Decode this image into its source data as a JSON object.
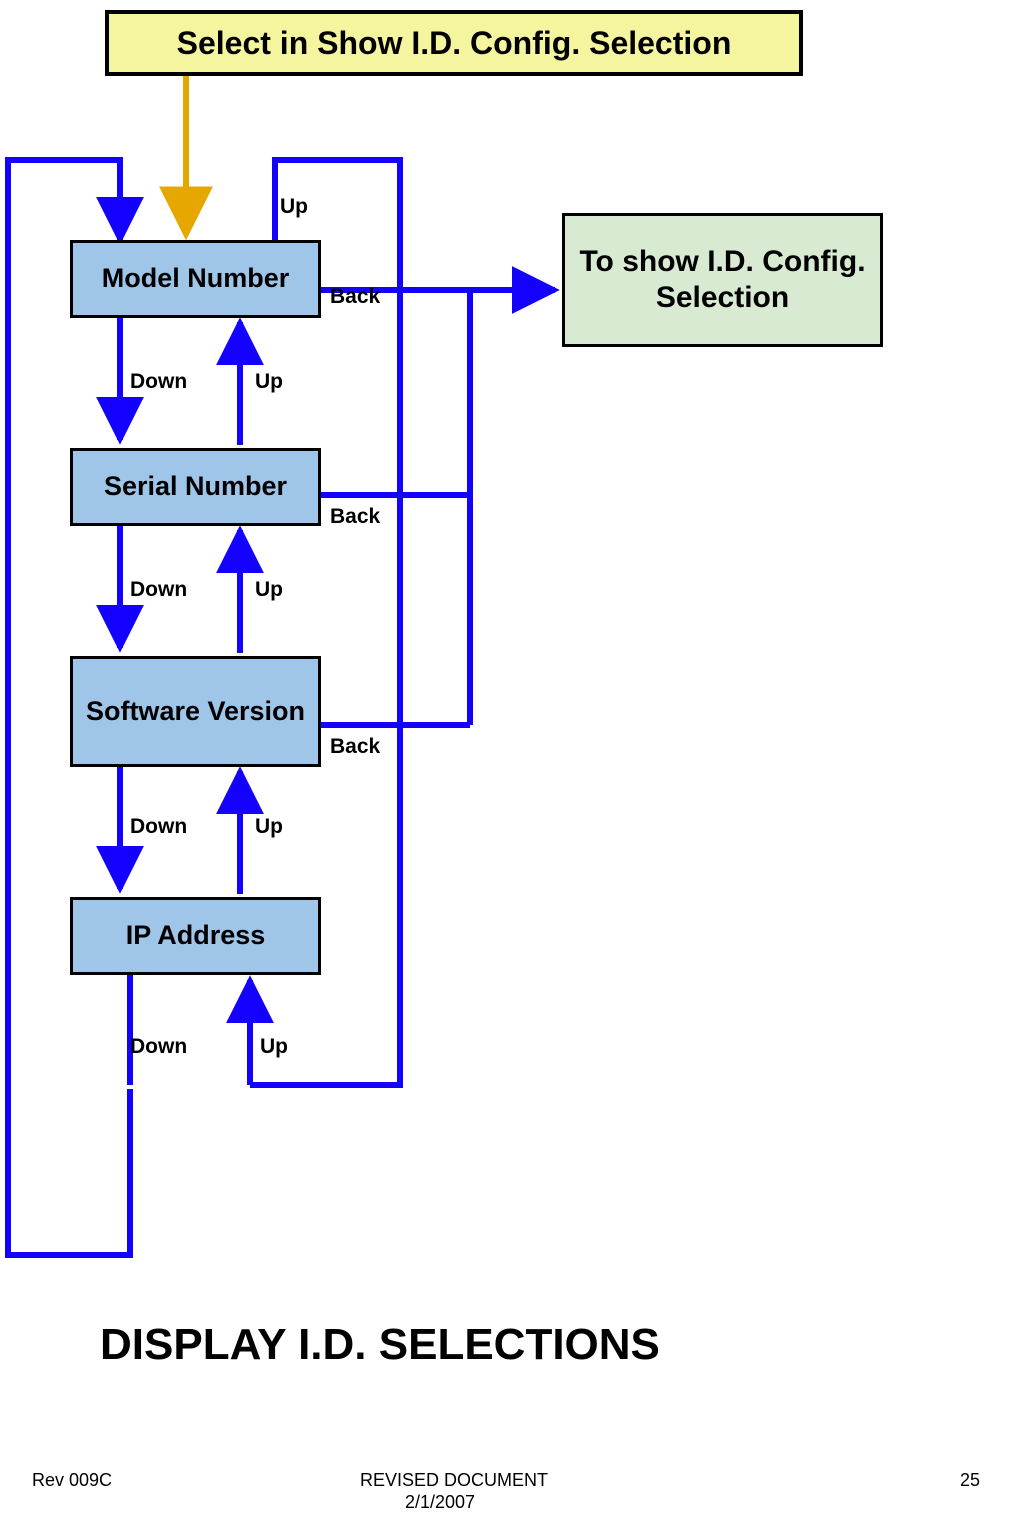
{
  "header": {
    "title": "Select in Show I.D. Config. Selection"
  },
  "nodes": {
    "model": {
      "label": "Model Number"
    },
    "serial": {
      "label": "Serial Number"
    },
    "soft": {
      "label": "Software Version"
    },
    "ip": {
      "label": "IP Address"
    },
    "target": {
      "label": "To show I.D. Config. Selection"
    }
  },
  "labels": {
    "up": "Up",
    "down": "Down",
    "back": "Back"
  },
  "title": "DISPLAY I.D. SELECTIONS",
  "footer": {
    "rev": "Rev 009C",
    "doc": "REVISED DOCUMENT",
    "date": "2/1/2007",
    "page": "25"
  }
}
